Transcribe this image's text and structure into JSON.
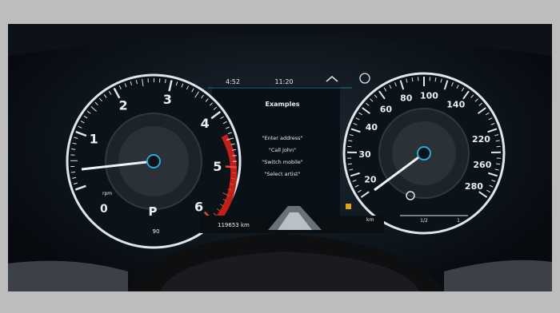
{
  "status_bar": {
    "left": "4:52",
    "center": "11:20"
  },
  "media_panel": {
    "title": "Examples",
    "commands": [
      "\"Enter address\"",
      "\"Call John\"",
      "\"Switch mobile\"",
      "\"Select artist\""
    ]
  },
  "tachometer": {
    "ticks": [
      "1",
      "2",
      "3",
      "4",
      "5",
      "6"
    ],
    "bottom_left": "0",
    "gear": "P",
    "bottom_center": "90",
    "unit_text": "rpm",
    "needle_value": 1.0
  },
  "speedometer": {
    "ticks": [
      "20",
      "30",
      "40",
      "60",
      "80",
      "100",
      "140",
      "220",
      "260",
      "280"
    ],
    "bottom_labels": [
      "1/2",
      "1"
    ],
    "needle_value": 0
  },
  "bottom_strip": {
    "odometer": "119653 km",
    "right_text": "km"
  },
  "colors": {
    "redline": "#c0201a",
    "accent": "#2aa8d8",
    "warning": "#e0a21a"
  }
}
